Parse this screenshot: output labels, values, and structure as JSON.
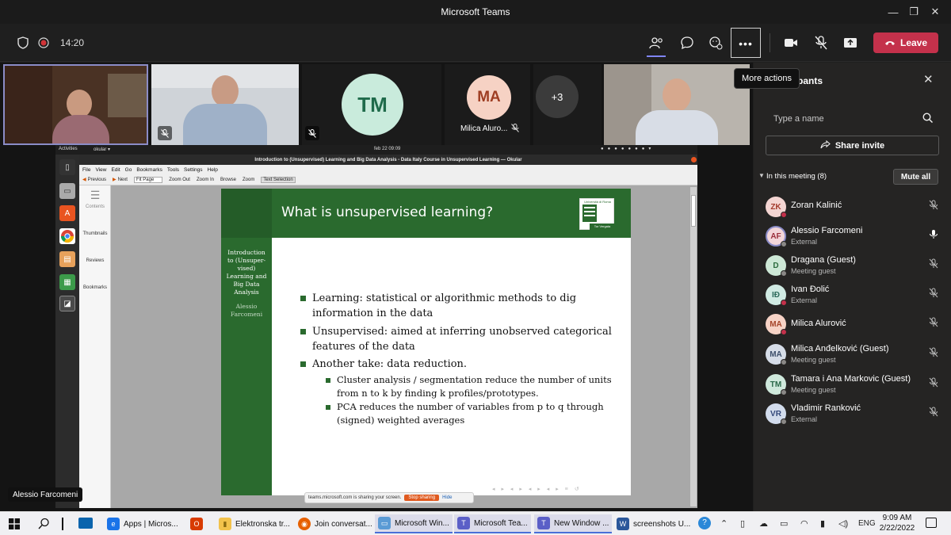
{
  "window": {
    "title": "Microsoft Teams",
    "minimize": "—",
    "maximize": "❐",
    "close": "✕"
  },
  "meeting": {
    "timer": "14:20",
    "more_actions_tooltip": "More actions",
    "leave_label": "Leave"
  },
  "video": {
    "tiles": [
      {
        "initials": "TM"
      },
      {
        "initials": "MA",
        "name": "Milica Aluro..."
      },
      {
        "initials": "+3"
      }
    ],
    "speaker_name": "Alessio Farcomeni"
  },
  "screen_share": {
    "ubuntu": {
      "activities": "Activities",
      "app": "okular ▾",
      "clock": "feb 22  09:09"
    },
    "okular": {
      "title": "Introduction to (Unsupervised) Learning and Big Data Analysis - Data Italy Course in Unsupervised Learning — Okular",
      "menu": [
        "File",
        "View",
        "Edit",
        "Go",
        "Bookmarks",
        "Tools",
        "Settings",
        "Help"
      ],
      "toolbar": {
        "previous": "Previous",
        "next": "Next",
        "fit": "Fit Page",
        "zoom_out": "Zoom Out",
        "zoom_in": "Zoom In",
        "browse": "Browse",
        "zoom": "Zoom",
        "text_selection": "Text Selection"
      },
      "sidebar": [
        "Contents",
        "Thumbnails",
        "Reviews",
        "Bookmarks"
      ]
    },
    "slide": {
      "title": "What is unsupervised learning?",
      "logo_top": "Università di Roma",
      "logo_bottom": "Tor Vergata",
      "side_lines": [
        "Introduction",
        "to (Unsuper-",
        "vised)",
        "Learning and",
        "Big Data",
        "Analysis"
      ],
      "side_author": [
        "Alessio",
        "Farcomeni"
      ],
      "bullets": [
        {
          "line1": "Learning:  statistical or algorithmic methods to dig",
          "line2": "information in the data"
        },
        {
          "line1": "Unsupervised:  aimed at inferring unobserved categorical",
          "line2": "features of the data"
        },
        {
          "line1": "Another take:  data reduction.",
          "line2": ""
        }
      ],
      "subbullets": [
        {
          "line1": "Cluster analysis / segmentation reduce the number of units",
          "line2": "from n to k by finding k profiles/prototypes."
        },
        {
          "line1": "PCA reduces the number of variables from p to q through",
          "line2": "(signed) weighted averages"
        }
      ]
    },
    "share_bar": {
      "text": "teams.microsoft.com is sharing your screen.",
      "stop": "Stop sharing",
      "hide": "Hide"
    }
  },
  "participants": {
    "header": "pants",
    "search_placeholder": "Type a name",
    "share_invite": "Share invite",
    "section": "In this meeting (8)",
    "mute_all": "Mute all",
    "people": [
      {
        "initials": "ZK",
        "name": "Zoran Kalinić",
        "sub": "",
        "color": "#f4d5d2",
        "text": "#a33b2d",
        "mic": "muted"
      },
      {
        "initials": "AF",
        "name": "Alessio Farcomeni",
        "sub": "External",
        "color": "#f3d6d9",
        "text": "#9b2f3b",
        "mic": "on"
      },
      {
        "initials": "D",
        "name": "Dragana (Guest)",
        "sub": "Meeting guest",
        "color": "#cde8d6",
        "text": "#2c6b3e",
        "mic": "muted"
      },
      {
        "initials": "IĐ",
        "name": "Ivan Đolić",
        "sub": "External",
        "color": "#d0ebe3",
        "text": "#2b6a5a",
        "mic": "muted"
      },
      {
        "initials": "MA",
        "name": "Milica Alurović",
        "sub": "",
        "color": "#f7d3c6",
        "text": "#a6452a",
        "mic": "muted"
      },
      {
        "initials": "MA",
        "name": "Milica Anđelković (Guest)",
        "sub": "Meeting guest",
        "color": "#d6dde8",
        "text": "#3d4f6b",
        "mic": "muted"
      },
      {
        "initials": "TM",
        "name": "Tamara i Ana Markovic (Guest)",
        "sub": "Meeting guest",
        "color": "#cfe9dc",
        "text": "#2b6a4a",
        "mic": "muted"
      },
      {
        "initials": "VR",
        "name": "Vladimir Ranković",
        "sub": "External",
        "color": "#d2dcec",
        "text": "#33487a",
        "mic": "muted"
      }
    ]
  },
  "taskbar": {
    "apps": [
      {
        "label": "Apps | Micros...",
        "color": "#1a73e8",
        "glyph": "e"
      },
      {
        "label": "",
        "color": "#d83b01",
        "glyph": "O"
      },
      {
        "label": "Elektronska tr...",
        "color": "#f2c24b",
        "glyph": "▮"
      },
      {
        "label": "Join conversat...",
        "color": "#e66000",
        "glyph": "◉"
      },
      {
        "label": "Microsoft Win...",
        "color": "#5b9bd5",
        "glyph": "▭"
      },
      {
        "label": "Microsoft Tea...",
        "color": "#5b5fc7",
        "glyph": "T"
      },
      {
        "label": "New Window ...",
        "color": "#5b5fc7",
        "glyph": "T"
      },
      {
        "label": "screenshots U...",
        "color": "#2b579a",
        "glyph": "W"
      }
    ],
    "lang": "ENG",
    "time": "9:09 AM",
    "date": "2/22/2022"
  }
}
